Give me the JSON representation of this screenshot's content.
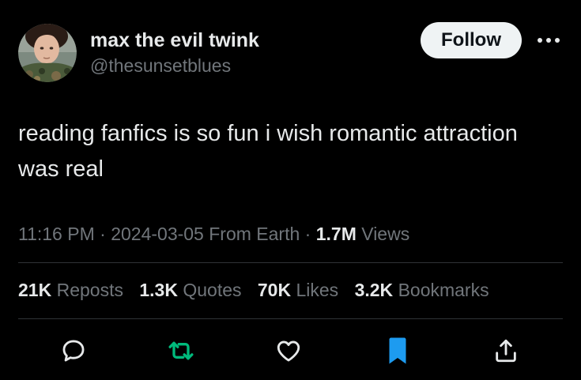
{
  "colors": {
    "background": "#000000",
    "text_primary": "#e7e9ea",
    "text_secondary": "#71767b",
    "divider": "#2f3336",
    "follow_bg": "#eff3f4",
    "repost_green": "#00ba7c",
    "bookmark_blue": "#1d9bf0"
  },
  "author": {
    "name": "max the evil twink",
    "handle": "@thesunsetblues"
  },
  "header": {
    "follow_label": "Follow",
    "more_icon": "more-horizontal-icon"
  },
  "tweet": {
    "text": "reading fanfics is so fun i wish romantic attraction was real"
  },
  "meta": {
    "time": "11:16 PM",
    "separator": "·",
    "date": "2024-03-05",
    "source": "From Earth",
    "views_count": "1.7M",
    "views_label": "Views"
  },
  "stats": [
    {
      "count": "21K",
      "label": "Reposts"
    },
    {
      "count": "1.3K",
      "label": "Quotes"
    },
    {
      "count": "70K",
      "label": "Likes"
    },
    {
      "count": "3.2K",
      "label": "Bookmarks"
    }
  ],
  "actions": [
    {
      "icon": "reply-icon"
    },
    {
      "icon": "repost-icon"
    },
    {
      "icon": "like-icon"
    },
    {
      "icon": "bookmark-icon"
    },
    {
      "icon": "share-icon"
    }
  ]
}
